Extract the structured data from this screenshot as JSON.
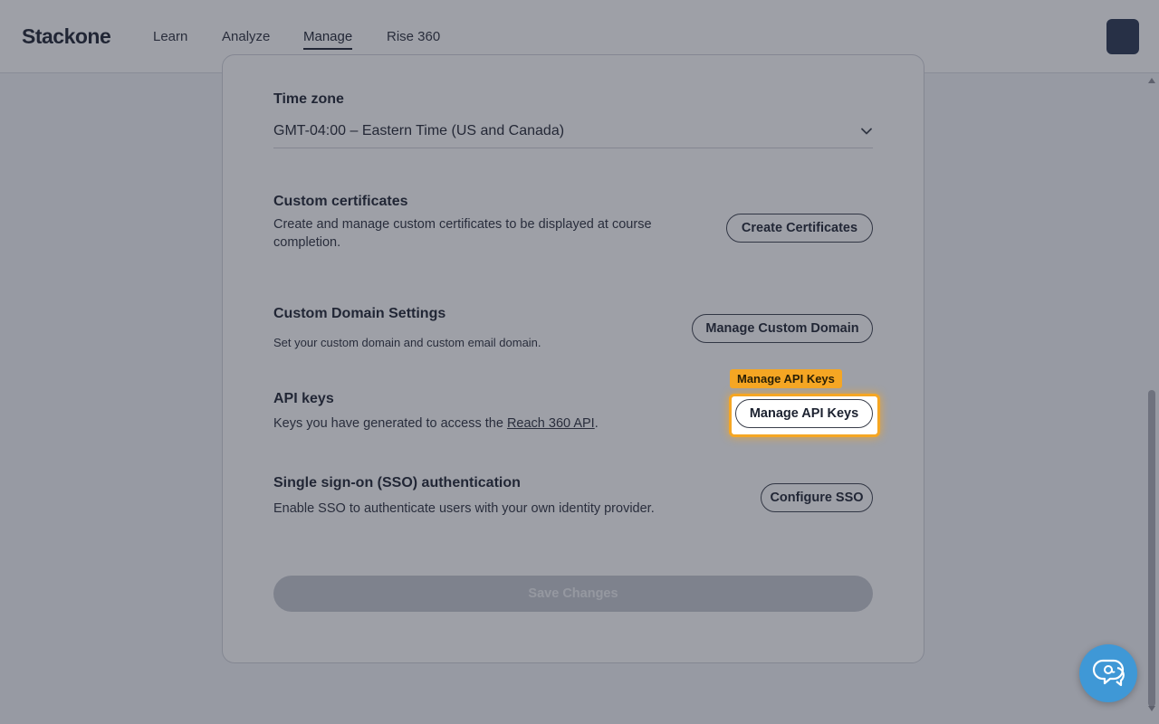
{
  "header": {
    "logo": "Stackone",
    "nav": [
      {
        "label": "Learn",
        "active": false
      },
      {
        "label": "Analyze",
        "active": false
      },
      {
        "label": "Manage",
        "active": true
      },
      {
        "label": "Rise 360",
        "active": false
      }
    ]
  },
  "settings": {
    "timezone": {
      "title": "Time zone",
      "value": "GMT-04:00 – Eastern Time (US and Canada)"
    },
    "certificates": {
      "title": "Custom certificates",
      "description": "Create and manage custom certificates to be displayed at course completion.",
      "button": "Create Certificates"
    },
    "domain": {
      "title": "Custom Domain Settings",
      "description": "Set your custom domain and custom email domain.",
      "button": "Manage Custom Domain"
    },
    "api_keys": {
      "title": "API keys",
      "description_prefix": "Keys you have generated to access the ",
      "link": "Reach 360 API",
      "description_suffix": ".",
      "button": "Manage API Keys"
    },
    "sso": {
      "title": "Single sign-on (SSO) authentication",
      "description": "Enable SSO to authenticate users with your own identity provider.",
      "button": "Configure SSO"
    },
    "save_button": "Save Changes"
  },
  "highlight": {
    "tag": "Manage API Keys",
    "color": "#f5a623"
  },
  "colors": {
    "help_bubble": "#3f98d6",
    "avatar": "#27344f"
  }
}
